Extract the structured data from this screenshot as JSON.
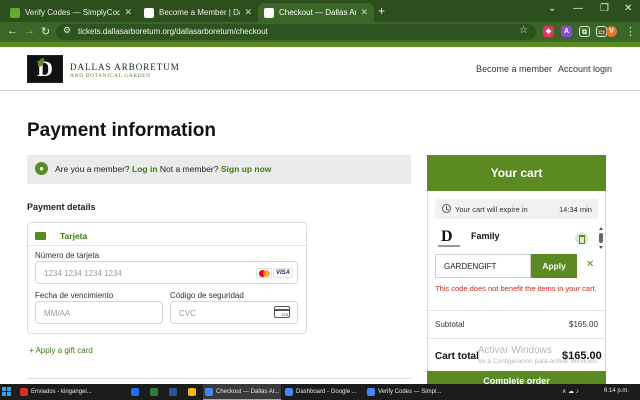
{
  "browser": {
    "tabs": [
      {
        "label": "Verify Codes — SimplyCodes",
        "active": false,
        "favicon_color": "#66aa33"
      },
      {
        "label": "Become a Member | Dallas Arbo",
        "active": false,
        "favicon_color": "#ffffff"
      },
      {
        "label": "Checkout — Dallas Arboretum",
        "active": true,
        "favicon_color": "#ffffff"
      }
    ],
    "new_tab_icon": "+",
    "window_controls": [
      "⌄",
      "—",
      "❐",
      "✕"
    ],
    "url": "tickets.dallasarboretum.org/dallasarboretum/checkout",
    "extensions": [
      {
        "name": "shield-icon",
        "color": "#e0345a",
        "glyph": "◆"
      },
      {
        "name": "a-icon",
        "color": "#8a4bd6",
        "glyph": "A"
      },
      {
        "name": "puzzle-icon",
        "color": "#3a6627",
        "glyph": "⧉"
      },
      {
        "name": "sidebar-icon",
        "color": "#3a6627",
        "glyph": "▭"
      },
      {
        "name": "profile-avatar",
        "color": "#e8742a",
        "glyph": "V"
      }
    ]
  },
  "site": {
    "logo_letter": "D",
    "logo_name": "DALLAS ARBORETUM",
    "logo_sub": "AND BOTANICAL GARDEN",
    "nav": {
      "become_member": "Become a member",
      "account_login": "Account login"
    }
  },
  "payment": {
    "title": "Payment information",
    "member_prompt": {
      "question": "Are you a member?",
      "login_link": "Log in",
      "not_member": "Not a member?",
      "signup_link": "Sign up now"
    },
    "details_heading": "Payment details",
    "method_tab": "Tarjeta",
    "card_number": {
      "label": "Número de tarjeta",
      "placeholder": "1234 1234 1234 1234"
    },
    "expiry": {
      "label": "Fecha de vencimiento",
      "placeholder": "MM/AA"
    },
    "security": {
      "label": "Código de seguridad",
      "placeholder": "CVC"
    },
    "card_brands": [
      "mastercard",
      "VISA"
    ],
    "cvc_icon_text": "123",
    "gift_card_link": "+ Apply a gift card"
  },
  "cart": {
    "title": "Your cart",
    "expiry_text": "Your cart will expire in",
    "expiry_time": "14:34 min",
    "item": {
      "name": "Family",
      "logo_letter": "D"
    },
    "promo": {
      "code": "GARDENGIFT",
      "apply_label": "Apply",
      "clear_icon": "✕"
    },
    "promo_error": "This code does not benefit the items in your cart.",
    "subtotal_label": "Subtotal",
    "subtotal_value": "$165.00",
    "total_label": "Cart total",
    "total_value": "$165.00",
    "checkout_label": "Complete order"
  },
  "watermark": {
    "title": "Activar Windows",
    "subtitle": "Ve a Configuración para activar Windows."
  },
  "taskbar": {
    "items": [
      {
        "label": "Enviados - kingangel...",
        "icon_color": "#d93025"
      },
      {
        "label": "Checkout — Dallas Ar...",
        "icon_color": "#4285f4",
        "active": true
      },
      {
        "label": "Dashboard - Google ...",
        "icon_color": "#4285f4"
      },
      {
        "label": "Verify Codes — Simpl...",
        "icon_color": "#4285f4"
      }
    ],
    "pinned_colors": [
      "#1f6feb",
      "#2e7d32",
      "#f2b705",
      "#2b579a"
    ],
    "clock": "6:14 p.m.",
    "tray_icons": "∧ ☁ ♪"
  }
}
